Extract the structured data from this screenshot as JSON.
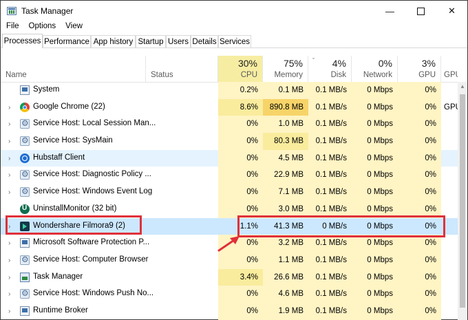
{
  "window": {
    "title": "Task Manager",
    "minimize": "—",
    "close": "✕",
    "icon": "task-manager-icon"
  },
  "menu": [
    "File",
    "Options",
    "View"
  ],
  "tabs": [
    "Processes",
    "Performance",
    "App history",
    "Startup",
    "Users",
    "Details",
    "Services"
  ],
  "header": {
    "name": "Name",
    "status": "Status",
    "cpu": {
      "pct": "30%",
      "label": "CPU"
    },
    "memory": {
      "pct": "75%",
      "label": "Memory"
    },
    "disk": {
      "pct": "4%",
      "label": "Disk"
    },
    "network": {
      "pct": "0%",
      "label": "Network"
    },
    "gpu": {
      "pct": "3%",
      "label": "GPU"
    },
    "gpu_engine": {
      "label": "GPU en"
    },
    "sort_indicator": "ˇ"
  },
  "rows": [
    {
      "name": "System",
      "icon": "system-icon",
      "expander": "",
      "cpu": "0.2%",
      "mem": "0.1 MB",
      "disk": "0.1 MB/s",
      "net": "0 Mbps",
      "gpu": "0%",
      "gpue": ""
    },
    {
      "name": "Google Chrome (22)",
      "icon": "chrome-icon",
      "expander": "›",
      "cpu": "8.6%",
      "mem": "890.8 MB",
      "disk": "0.1 MB/s",
      "net": "0 Mbps",
      "gpu": "0%",
      "gpue": "GPU"
    },
    {
      "name": "Service Host: Local Session Man...",
      "icon": "gear-icon",
      "expander": "›",
      "cpu": "0%",
      "mem": "1.0 MB",
      "disk": "0.1 MB/s",
      "net": "0 Mbps",
      "gpu": "0%",
      "gpue": ""
    },
    {
      "name": "Service Host: SysMain",
      "icon": "gear-icon",
      "expander": "›",
      "cpu": "0%",
      "mem": "80.3 MB",
      "disk": "0.1 MB/s",
      "net": "0 Mbps",
      "gpu": "0%",
      "gpue": ""
    },
    {
      "name": "Hubstaff Client",
      "icon": "hubstaff-icon",
      "expander": "›",
      "cpu": "0%",
      "mem": "4.5 MB",
      "disk": "0.1 MB/s",
      "net": "0 Mbps",
      "gpu": "0%",
      "gpue": ""
    },
    {
      "name": "Service Host: Diagnostic Policy ...",
      "icon": "gear-icon",
      "expander": "›",
      "cpu": "0%",
      "mem": "22.9 MB",
      "disk": "0.1 MB/s",
      "net": "0 Mbps",
      "gpu": "0%",
      "gpue": ""
    },
    {
      "name": "Service Host: Windows Event Log",
      "icon": "gear-icon",
      "expander": "›",
      "cpu": "0%",
      "mem": "7.1 MB",
      "disk": "0.1 MB/s",
      "net": "0 Mbps",
      "gpu": "0%",
      "gpue": ""
    },
    {
      "name": "UninstallMonitor (32 bit)",
      "icon": "uninstall-icon",
      "expander": "",
      "cpu": "0%",
      "mem": "3.0 MB",
      "disk": "0.1 MB/s",
      "net": "0 Mbps",
      "gpu": "0%",
      "gpue": ""
    },
    {
      "name": "Wondershare Filmora9 (2)",
      "icon": "filmora-icon",
      "expander": "›",
      "cpu": "1.1%",
      "mem": "41.3 MB",
      "disk": "0 MB/s",
      "net": "0 Mbps",
      "gpu": "0%",
      "gpue": ""
    },
    {
      "name": "Microsoft Software Protection P...",
      "icon": "system-icon",
      "expander": "›",
      "cpu": "0%",
      "mem": "3.2 MB",
      "disk": "0.1 MB/s",
      "net": "0 Mbps",
      "gpu": "0%",
      "gpue": ""
    },
    {
      "name": "Service Host: Computer Browser",
      "icon": "gear-icon",
      "expander": "›",
      "cpu": "0%",
      "mem": "1.1 MB",
      "disk": "0.1 MB/s",
      "net": "0 Mbps",
      "gpu": "0%",
      "gpue": ""
    },
    {
      "name": "Task Manager",
      "icon": "task-manager-icon",
      "expander": "›",
      "cpu": "3.4%",
      "mem": "26.6 MB",
      "disk": "0.1 MB/s",
      "net": "0 Mbps",
      "gpu": "0%",
      "gpue": ""
    },
    {
      "name": "Service Host: Windows Push No...",
      "icon": "gear-icon",
      "expander": "›",
      "cpu": "0%",
      "mem": "4.6 MB",
      "disk": "0.1 MB/s",
      "net": "0 Mbps",
      "gpu": "0%",
      "gpue": ""
    },
    {
      "name": "Runtime Broker",
      "icon": "system-icon",
      "expander": "›",
      "cpu": "0%",
      "mem": "1.9 MB",
      "disk": "0.1 MB/s",
      "net": "0 Mbps",
      "gpu": "0%",
      "gpue": ""
    }
  ],
  "colors": {
    "highlight": "#e0303a",
    "selected_row": "#cce8ff",
    "heat_light": "#fff4c4",
    "heat_mid": "#f9ec9d",
    "heat_high": "#f7d469"
  }
}
